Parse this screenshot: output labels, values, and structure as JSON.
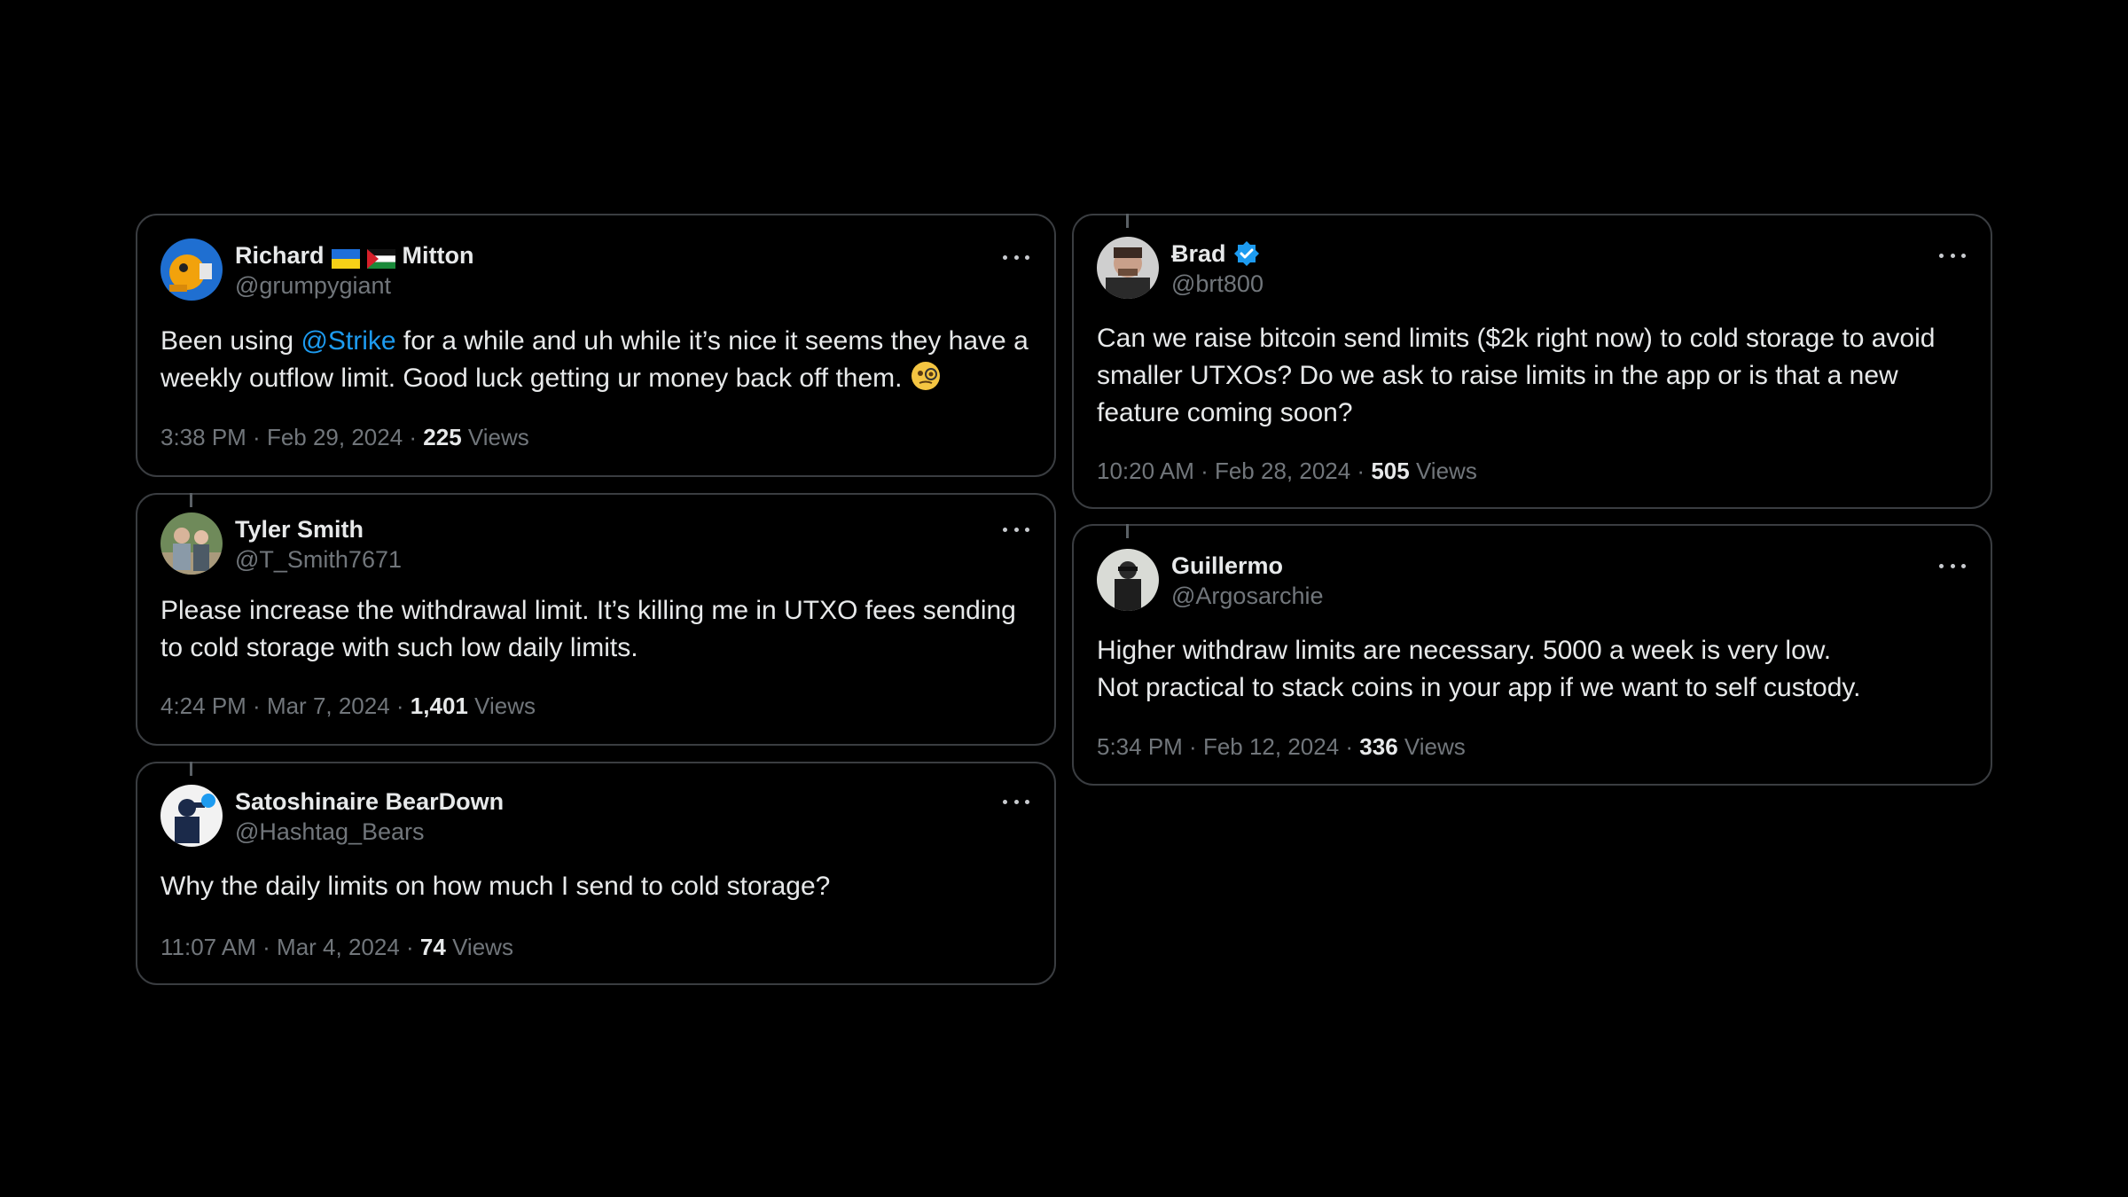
{
  "tweets": [
    {
      "name_first": "Richard",
      "name_last": "Mitton",
      "handle": "@grumpygiant",
      "text_before": "Been using ",
      "mention": "@Strike",
      "text_after": " for a while and uh while it’s nice it seems they have a weekly outflow limit. Good luck getting ur money back off them.",
      "time": "3:38 PM",
      "date": "Feb 29, 2024",
      "views_count": "225",
      "views_label": "Views",
      "icons": [
        "ukraine-flag",
        "palestine-flag",
        "monocle-face-emoji"
      ]
    },
    {
      "name": "Tyler Smith",
      "handle": "@T_Smith7671",
      "text": "Please increase the withdrawal limit. It’s killing me in UTXO fees sending to cold storage with such low daily limits.",
      "time": "4:24 PM",
      "date": "Mar 7, 2024",
      "views_count": "1,401",
      "views_label": "Views"
    },
    {
      "name": "Satoshinaire BearDown",
      "handle": "@Hashtag_Bears",
      "text": "Why the daily limits on how much I send to cold storage?",
      "time": "11:07 AM",
      "date": "Mar 4, 2024",
      "views_count": "74",
      "views_label": "Views"
    },
    {
      "name": "Ƀrad",
      "handle": "@brt800",
      "verified": true,
      "text": "Can we raise bitcoin send limits ($2k right now) to cold storage to avoid smaller UTXOs? Do we ask to raise limits in the app or is that a new feature coming soon?",
      "time": "10:20 AM",
      "date": "Feb 28, 2024",
      "views_count": "505",
      "views_label": "Views"
    },
    {
      "name": "Guillermo",
      "handle": "@Argosarchie",
      "text_line1": "Higher withdraw limits are necessary. 5000 a week is very low.",
      "text_line2": "Not practical to stack coins in your app if we want to self custody.",
      "time": "5:34 PM",
      "date": "Feb 12, 2024",
      "views_count": "336",
      "views_label": "Views"
    }
  ],
  "colors": {
    "background": "#000000",
    "border": "#3a3d41",
    "text": "#e7e9ea",
    "muted": "#71767b",
    "accent": "#1d9bf0"
  }
}
